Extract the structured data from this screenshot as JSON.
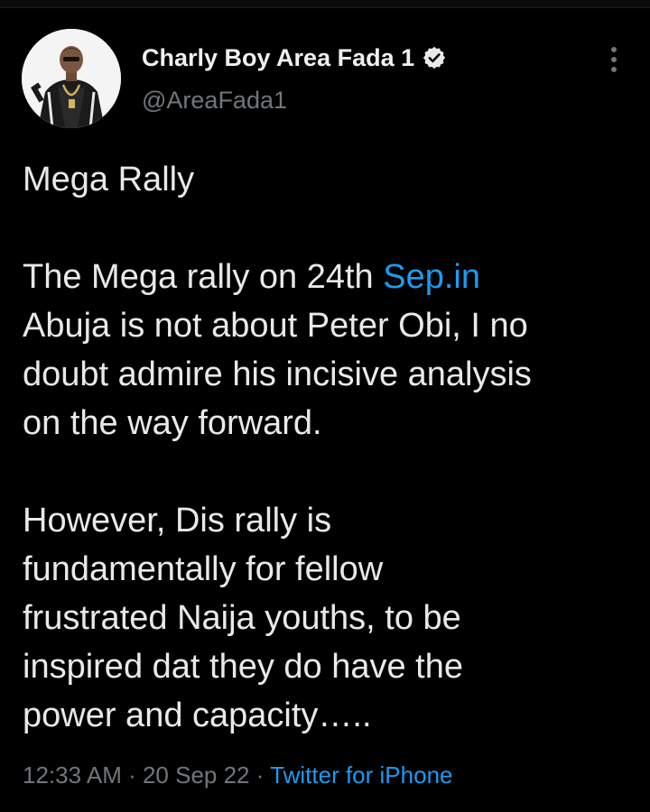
{
  "colors": {
    "background": "#000000",
    "text": "#e7e9ea",
    "muted": "#71767b",
    "link": "#1d9bf0"
  },
  "tweet": {
    "author": {
      "display_name": "Charly Boy Area Fada 1",
      "handle": "@AreaFada1",
      "verified": true,
      "avatar_icon": "avatar"
    },
    "more_icon": "more-vertical-icon",
    "body": {
      "title": "Mega Rally",
      "p1": {
        "l1_a": "The Mega rally on 24th ",
        "l1_link": "Sep.in",
        "l2": "Abuja is not about Peter Obi, I no",
        "l3": "doubt admire his incisive analysis",
        "l4": "on the way forward."
      },
      "p2": {
        "l1": "However, Dis rally is",
        "l2": "fundamentally for fellow",
        "l3": "frustrated Naija youths, to be",
        "l4": "inspired dat they do have the",
        "l5": "power and capacity….."
      }
    },
    "meta": {
      "time": "12:33 AM",
      "sep": " · ",
      "date": "20 Sep 22",
      "source": "Twitter for iPhone"
    }
  }
}
